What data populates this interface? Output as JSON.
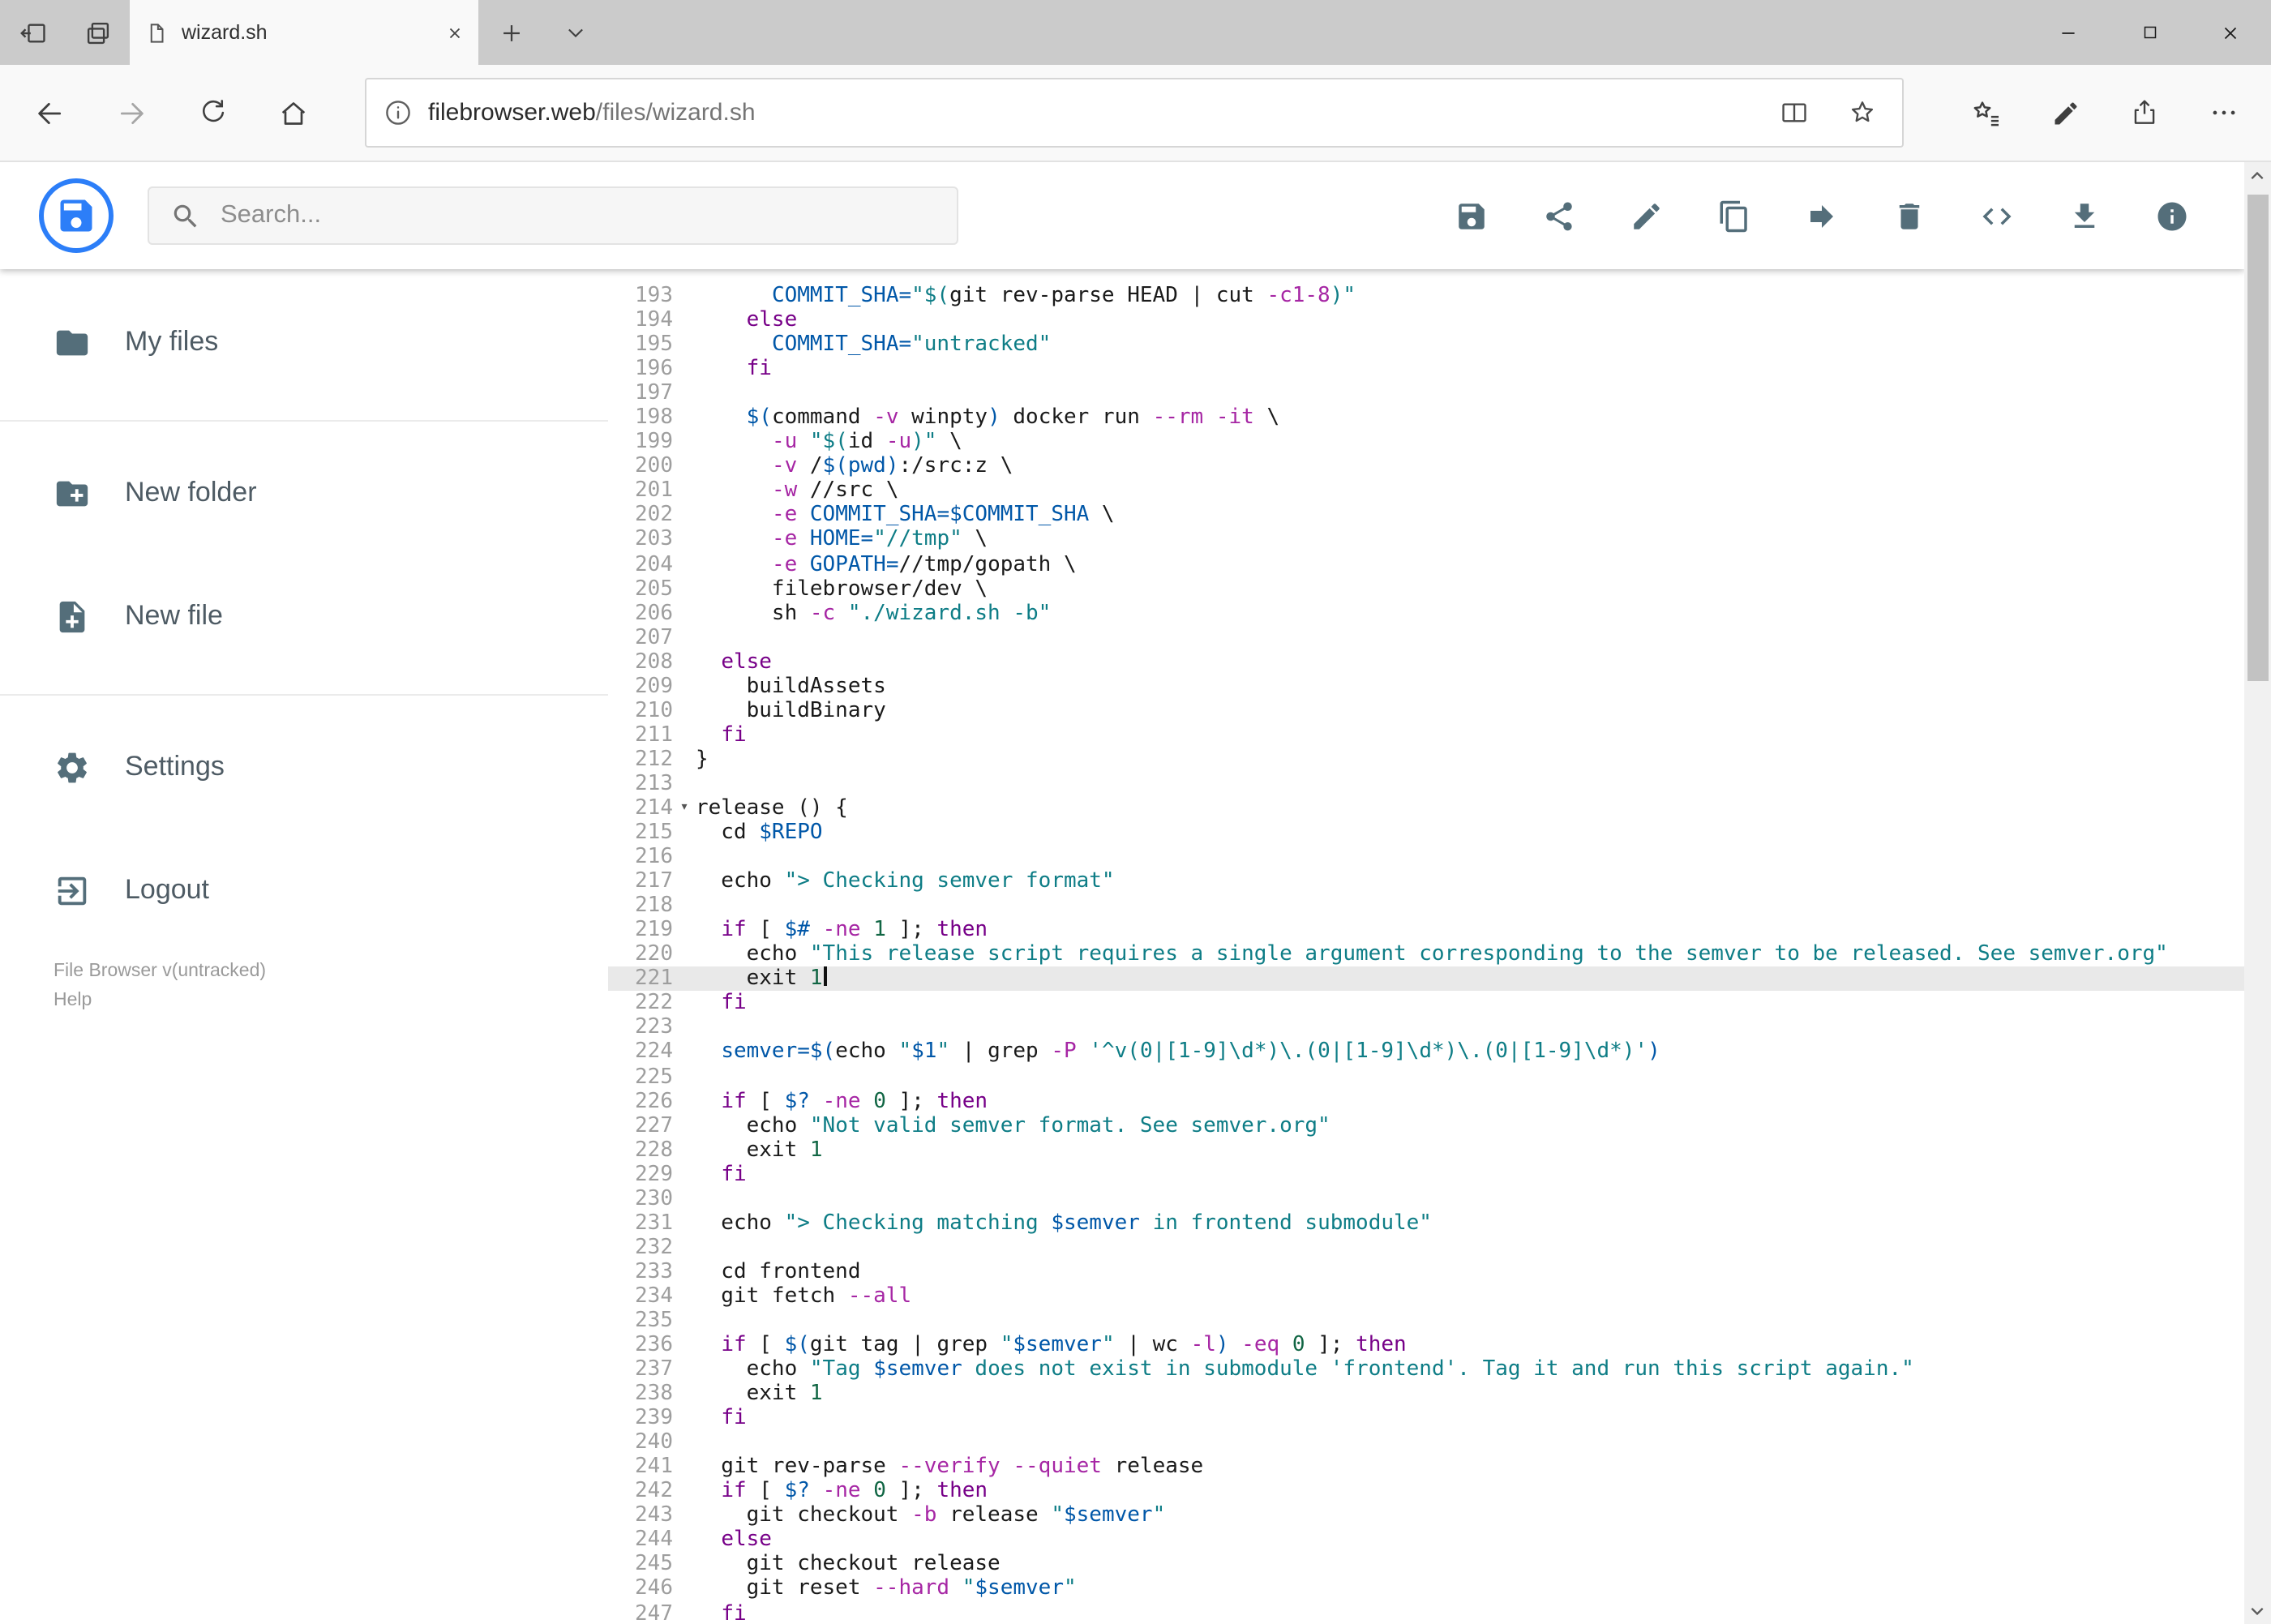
{
  "browser": {
    "tab": {
      "title": "wizard.sh"
    },
    "url": {
      "host": "filebrowser.web",
      "path": "/files/wizard.sh"
    }
  },
  "header": {
    "search": {
      "placeholder": "Search..."
    },
    "actions": [
      {
        "name": "save",
        "icon": "save-icon"
      },
      {
        "name": "share",
        "icon": "share-icon"
      },
      {
        "name": "edit",
        "icon": "edit-icon"
      },
      {
        "name": "copy",
        "icon": "copy-icon"
      },
      {
        "name": "move",
        "icon": "move-icon"
      },
      {
        "name": "delete",
        "icon": "delete-icon"
      },
      {
        "name": "code",
        "icon": "code-icon"
      },
      {
        "name": "download",
        "icon": "download-icon"
      },
      {
        "name": "info",
        "icon": "info-icon"
      }
    ]
  },
  "sidebar": {
    "items": [
      {
        "label": "My files",
        "icon": "folder-icon",
        "divider_after": true
      },
      {
        "label": "New folder",
        "icon": "new-folder-icon",
        "divider_after": false
      },
      {
        "label": "New file",
        "icon": "new-file-icon",
        "divider_after": true
      },
      {
        "label": "Settings",
        "icon": "settings-icon",
        "divider_after": false
      },
      {
        "label": "Logout",
        "icon": "logout-icon",
        "divider_after": false
      }
    ],
    "footer": {
      "version": "File Browser v(untracked)",
      "help": "Help"
    }
  },
  "editor": {
    "active_line": 221,
    "folded_line": 214,
    "lines": [
      {
        "n": 193,
        "s": [
          [
            "",
            "      "
          ],
          [
            "v",
            "COMMIT_SHA="
          ],
          [
            "s",
            "\"$("
          ],
          [
            "",
            "git rev-parse HEAD | cut "
          ],
          [
            "a",
            "-c1-8"
          ],
          [
            "s",
            ")\""
          ]
        ]
      },
      {
        "n": 194,
        "s": [
          [
            "",
            "    "
          ],
          [
            "k",
            "else"
          ]
        ]
      },
      {
        "n": 195,
        "s": [
          [
            "",
            "      "
          ],
          [
            "v",
            "COMMIT_SHA="
          ],
          [
            "s",
            "\"untracked\""
          ]
        ]
      },
      {
        "n": 196,
        "s": [
          [
            "",
            "    "
          ],
          [
            "k",
            "fi"
          ]
        ]
      },
      {
        "n": 197,
        "s": []
      },
      {
        "n": 198,
        "s": [
          [
            "",
            "    "
          ],
          [
            "v",
            "$("
          ],
          [
            "",
            "command "
          ],
          [
            "a",
            "-v"
          ],
          [
            "",
            " winpty"
          ],
          [
            "v",
            ")"
          ],
          [
            "",
            " docker run "
          ],
          [
            "a",
            "--rm"
          ],
          [
            "",
            " "
          ],
          [
            "a",
            "-it"
          ],
          [
            "",
            " \\"
          ]
        ]
      },
      {
        "n": 199,
        "s": [
          [
            "",
            "      "
          ],
          [
            "a",
            "-u"
          ],
          [
            "",
            " "
          ],
          [
            "s",
            "\"$("
          ],
          [
            "",
            "id "
          ],
          [
            "a",
            "-u"
          ],
          [
            "s",
            ")\""
          ],
          [
            "",
            " \\"
          ]
        ]
      },
      {
        "n": 200,
        "s": [
          [
            "",
            "      "
          ],
          [
            "a",
            "-v"
          ],
          [
            "",
            " /"
          ],
          [
            "v",
            "$(pwd)"
          ],
          [
            "",
            ":/src:z \\"
          ]
        ]
      },
      {
        "n": 201,
        "s": [
          [
            "",
            "      "
          ],
          [
            "a",
            "-w"
          ],
          [
            "",
            " //src \\"
          ]
        ]
      },
      {
        "n": 202,
        "s": [
          [
            "",
            "      "
          ],
          [
            "a",
            "-e"
          ],
          [
            "",
            " "
          ],
          [
            "v",
            "COMMIT_SHA=$COMMIT_SHA"
          ],
          [
            "",
            " \\"
          ]
        ]
      },
      {
        "n": 203,
        "s": [
          [
            "",
            "      "
          ],
          [
            "a",
            "-e"
          ],
          [
            "",
            " "
          ],
          [
            "v",
            "HOME="
          ],
          [
            "s",
            "\"//tmp\""
          ],
          [
            "",
            " \\"
          ]
        ]
      },
      {
        "n": 204,
        "s": [
          [
            "",
            "      "
          ],
          [
            "a",
            "-e"
          ],
          [
            "",
            " "
          ],
          [
            "v",
            "GOPATH="
          ],
          [
            "",
            "//tmp/gopath \\"
          ]
        ]
      },
      {
        "n": 205,
        "s": [
          [
            "",
            "      filebrowser/dev \\"
          ]
        ]
      },
      {
        "n": 206,
        "s": [
          [
            "",
            "      sh "
          ],
          [
            "a",
            "-c"
          ],
          [
            "",
            " "
          ],
          [
            "s",
            "\"./wizard.sh -b\""
          ]
        ]
      },
      {
        "n": 207,
        "s": []
      },
      {
        "n": 208,
        "s": [
          [
            "",
            "  "
          ],
          [
            "k",
            "else"
          ]
        ]
      },
      {
        "n": 209,
        "s": [
          [
            "",
            "    buildAssets"
          ]
        ]
      },
      {
        "n": 210,
        "s": [
          [
            "",
            "    buildBinary"
          ]
        ]
      },
      {
        "n": 211,
        "s": [
          [
            "",
            "  "
          ],
          [
            "k",
            "fi"
          ]
        ]
      },
      {
        "n": 212,
        "s": [
          [
            "",
            "}"
          ]
        ]
      },
      {
        "n": 213,
        "s": []
      },
      {
        "n": 214,
        "s": [
          [
            "",
            "release () {"
          ]
        ]
      },
      {
        "n": 215,
        "s": [
          [
            "",
            "  cd "
          ],
          [
            "v",
            "$REPO"
          ]
        ]
      },
      {
        "n": 216,
        "s": []
      },
      {
        "n": 217,
        "s": [
          [
            "",
            "  echo "
          ],
          [
            "s",
            "\"> Checking semver format\""
          ]
        ]
      },
      {
        "n": 218,
        "s": []
      },
      {
        "n": 219,
        "s": [
          [
            "",
            "  "
          ],
          [
            "k",
            "if"
          ],
          [
            "",
            " [ "
          ],
          [
            "v",
            "$#"
          ],
          [
            "",
            " "
          ],
          [
            "a",
            "-ne"
          ],
          [
            "",
            " "
          ],
          [
            "d",
            "1"
          ],
          [
            "",
            " ]; "
          ],
          [
            "k",
            "then"
          ]
        ]
      },
      {
        "n": 220,
        "s": [
          [
            "",
            "    echo "
          ],
          [
            "s",
            "\"This release script requires a single argument corresponding to the semver to be released. See semver.org\""
          ]
        ]
      },
      {
        "n": 221,
        "s": [
          [
            "",
            "    exit "
          ],
          [
            "d",
            "1"
          ]
        ]
      },
      {
        "n": 222,
        "s": [
          [
            "",
            "  "
          ],
          [
            "k",
            "fi"
          ]
        ]
      },
      {
        "n": 223,
        "s": []
      },
      {
        "n": 224,
        "s": [
          [
            "",
            "  "
          ],
          [
            "v",
            "semver="
          ],
          [
            "v",
            "$("
          ],
          [
            "",
            "echo "
          ],
          [
            "s",
            "\""
          ],
          [
            "v",
            "$1"
          ],
          [
            "s",
            "\""
          ],
          [
            "",
            " | grep "
          ],
          [
            "a",
            "-P"
          ],
          [
            "",
            " "
          ],
          [
            "s",
            "'^v(0|[1-9]\\d*)\\.(0|[1-9]\\d*)\\.(0|[1-9]\\d*)'"
          ],
          [
            "v",
            ")"
          ]
        ]
      },
      {
        "n": 225,
        "s": []
      },
      {
        "n": 226,
        "s": [
          [
            "",
            "  "
          ],
          [
            "k",
            "if"
          ],
          [
            "",
            " [ "
          ],
          [
            "v",
            "$?"
          ],
          [
            "",
            " "
          ],
          [
            "a",
            "-ne"
          ],
          [
            "",
            " "
          ],
          [
            "d",
            "0"
          ],
          [
            "",
            " ]; "
          ],
          [
            "k",
            "then"
          ]
        ]
      },
      {
        "n": 227,
        "s": [
          [
            "",
            "    echo "
          ],
          [
            "s",
            "\"Not valid semver format. See semver.org\""
          ]
        ]
      },
      {
        "n": 228,
        "s": [
          [
            "",
            "    exit "
          ],
          [
            "d",
            "1"
          ]
        ]
      },
      {
        "n": 229,
        "s": [
          [
            "",
            "  "
          ],
          [
            "k",
            "fi"
          ]
        ]
      },
      {
        "n": 230,
        "s": []
      },
      {
        "n": 231,
        "s": [
          [
            "",
            "  echo "
          ],
          [
            "s",
            "\"> Checking matching "
          ],
          [
            "v",
            "$semver"
          ],
          [
            "s",
            " in frontend submodule\""
          ]
        ]
      },
      {
        "n": 232,
        "s": []
      },
      {
        "n": 233,
        "s": [
          [
            "",
            "  cd frontend"
          ]
        ]
      },
      {
        "n": 234,
        "s": [
          [
            "",
            "  git fetch "
          ],
          [
            "a",
            "--all"
          ]
        ]
      },
      {
        "n": 235,
        "s": []
      },
      {
        "n": 236,
        "s": [
          [
            "",
            "  "
          ],
          [
            "k",
            "if"
          ],
          [
            "",
            " [ "
          ],
          [
            "v",
            "$("
          ],
          [
            "",
            "git tag | grep "
          ],
          [
            "s",
            "\""
          ],
          [
            "v",
            "$semver"
          ],
          [
            "s",
            "\""
          ],
          [
            "",
            " | wc "
          ],
          [
            "a",
            "-l"
          ],
          [
            "v",
            ")"
          ],
          [
            "",
            " "
          ],
          [
            "a",
            "-eq"
          ],
          [
            "",
            " "
          ],
          [
            "d",
            "0"
          ],
          [
            "",
            " ]; "
          ],
          [
            "k",
            "then"
          ]
        ]
      },
      {
        "n": 237,
        "s": [
          [
            "",
            "    echo "
          ],
          [
            "s",
            "\"Tag "
          ],
          [
            "v",
            "$semver"
          ],
          [
            "s",
            " does not exist in submodule 'frontend'. Tag it and run this script again.\""
          ]
        ]
      },
      {
        "n": 238,
        "s": [
          [
            "",
            "    exit "
          ],
          [
            "d",
            "1"
          ]
        ]
      },
      {
        "n": 239,
        "s": [
          [
            "",
            "  "
          ],
          [
            "k",
            "fi"
          ]
        ]
      },
      {
        "n": 240,
        "s": []
      },
      {
        "n": 241,
        "s": [
          [
            "",
            "  git rev-parse "
          ],
          [
            "a",
            "--verify"
          ],
          [
            "",
            " "
          ],
          [
            "a",
            "--quiet"
          ],
          [
            "",
            " release"
          ]
        ]
      },
      {
        "n": 242,
        "s": [
          [
            "",
            "  "
          ],
          [
            "k",
            "if"
          ],
          [
            "",
            " [ "
          ],
          [
            "v",
            "$?"
          ],
          [
            "",
            " "
          ],
          [
            "a",
            "-ne"
          ],
          [
            "",
            " "
          ],
          [
            "d",
            "0"
          ],
          [
            "",
            " ]; "
          ],
          [
            "k",
            "then"
          ]
        ]
      },
      {
        "n": 243,
        "s": [
          [
            "",
            "    git checkout "
          ],
          [
            "a",
            "-b"
          ],
          [
            "",
            " release "
          ],
          [
            "s",
            "\""
          ],
          [
            "v",
            "$semver"
          ],
          [
            "s",
            "\""
          ]
        ]
      },
      {
        "n": 244,
        "s": [
          [
            "",
            "  "
          ],
          [
            "k",
            "else"
          ]
        ]
      },
      {
        "n": 245,
        "s": [
          [
            "",
            "    git checkout release"
          ]
        ]
      },
      {
        "n": 246,
        "s": [
          [
            "",
            "    git reset "
          ],
          [
            "a",
            "--hard"
          ],
          [
            "",
            " "
          ],
          [
            "s",
            "\""
          ],
          [
            "v",
            "$semver"
          ],
          [
            "s",
            "\""
          ]
        ]
      },
      {
        "n": 247,
        "s": [
          [
            "",
            "  "
          ],
          [
            "k",
            "fi"
          ]
        ]
      }
    ]
  }
}
